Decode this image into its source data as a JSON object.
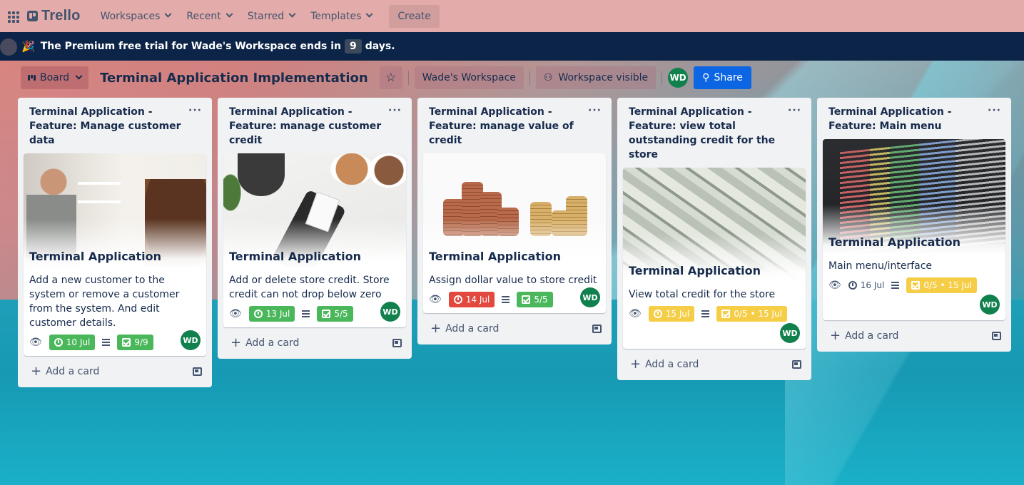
{
  "app": {
    "logo": "Trello"
  },
  "nav": {
    "workspaces": "Workspaces",
    "recent": "Recent",
    "starred": "Starred",
    "templates": "Templates",
    "create": "Create"
  },
  "banner": {
    "prefix": "The Premium free trial for Wade's Workspace ends in",
    "days": "9",
    "suffix": "days."
  },
  "board": {
    "view_label": "Board",
    "title": "Terminal Application Implementation",
    "workspace": "Wade's Workspace",
    "visibility": "Workspace visible",
    "member_initials": "WD",
    "share": "Share"
  },
  "lists": [
    {
      "title": "Terminal Application - Feature: Manage customer data",
      "card": {
        "cover_title": "Terminal Application",
        "text": "Add a new customer to the system or remove a customer from the system. And edit customer details.",
        "due": "10 Jul",
        "due_status": "green",
        "checklist": "9/9",
        "checklist_status": "green",
        "member": "WD"
      },
      "add_card": "Add a card"
    },
    {
      "title": "Terminal Application - Feature: manage customer credit",
      "card": {
        "cover_title": "Terminal Application",
        "text": "Add or delete store credit. Store credit can not drop below zero",
        "due": "13 Jul",
        "due_status": "green",
        "checklist": "5/5",
        "checklist_status": "green",
        "member": "WD"
      },
      "add_card": "Add a card"
    },
    {
      "title": "Terminal Application - Feature: manage value of credit",
      "card": {
        "cover_title": "Terminal Application",
        "text": "Assign dollar value to store credit",
        "due": "14 Jul",
        "due_status": "red",
        "checklist": "5/5",
        "checklist_status": "green",
        "member": "WD"
      },
      "add_card": "Add a card"
    },
    {
      "title": "Terminal Application - Feature: view total outstanding credit for the store",
      "card": {
        "cover_title": "Terminal Application",
        "text": "View total credit for the store",
        "due": "15 Jul",
        "due_status": "yellow",
        "checklist": "0/5 • 15 Jul",
        "checklist_status": "yellow",
        "member": "WD"
      },
      "add_card": "Add a card"
    },
    {
      "title": "Terminal Application - Feature: Main menu",
      "card": {
        "cover_title": "Terminal Application",
        "text": "Main menu/interface",
        "due": "16 Jul",
        "due_status": "plain",
        "checklist": "0/5 • 15 Jul",
        "checklist_status": "yellow",
        "member": "WD"
      },
      "add_card": "Add a card"
    }
  ],
  "colors": {
    "nav_bg": "#e3aba9",
    "banner_bg": "#0c2447",
    "share": "#0c66e4",
    "avatar": "#10804d",
    "badge_green": "#4bb75b",
    "badge_red": "#e2483d",
    "badge_yellow": "#f5cd47"
  }
}
